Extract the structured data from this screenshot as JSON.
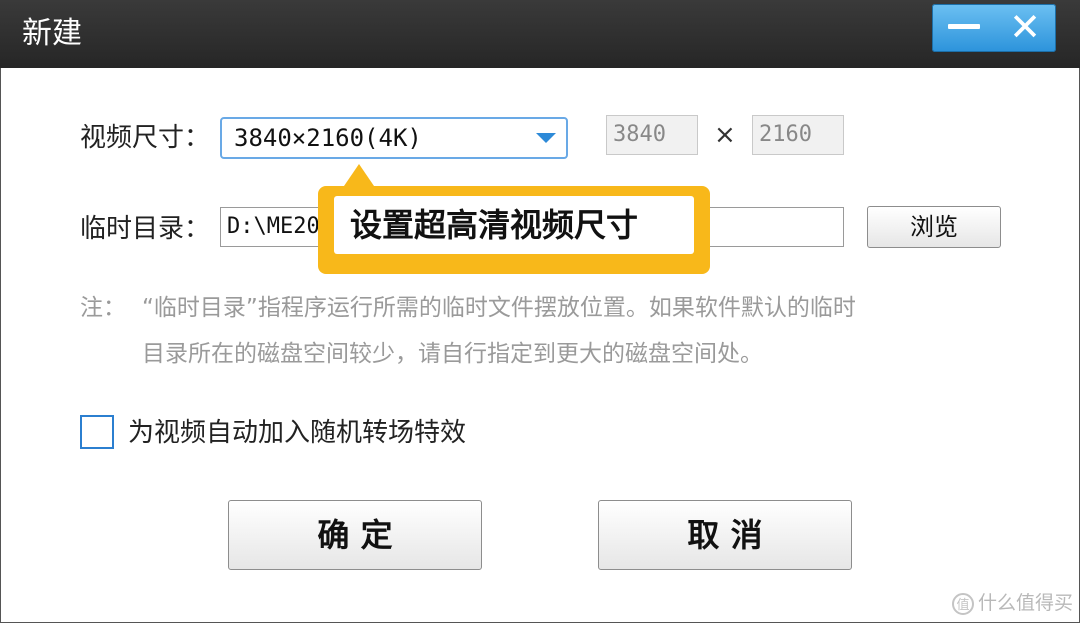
{
  "window": {
    "title": "新建",
    "minimize_icon": "minimize-icon",
    "close_glyph": "✕"
  },
  "form": {
    "video_size_label": "视频尺寸：",
    "video_size_value": "3840×2160(4K)",
    "width_value": "3840",
    "times_glyph": "×",
    "height_value": "2160",
    "temp_dir_label": "临时目录：",
    "temp_dir_value": "D:\\ME20",
    "browse_label": "浏览",
    "note_prefix": "注：",
    "note_line1": "“临时目录”指程序运行所需的临时文件摆放位置。如果软件默认的临时",
    "note_line2": "目录所在的磁盘空间较少，请自行指定到更大的磁盘空间处。",
    "checkbox_label": "为视频自动加入随机转场特效",
    "checkbox_checked": false
  },
  "buttons": {
    "ok_label": "确 定",
    "cancel_label": "取 消"
  },
  "tooltip": {
    "text": "设置超高清视频尺寸",
    "color": "#f8b81a"
  },
  "watermark": {
    "icon_text": "值",
    "text": "什么值得买"
  },
  "colors": {
    "titlebar": "#2e2e2e",
    "window_buttons": "#3ea3e6",
    "focus_border": "#69a9e6"
  }
}
